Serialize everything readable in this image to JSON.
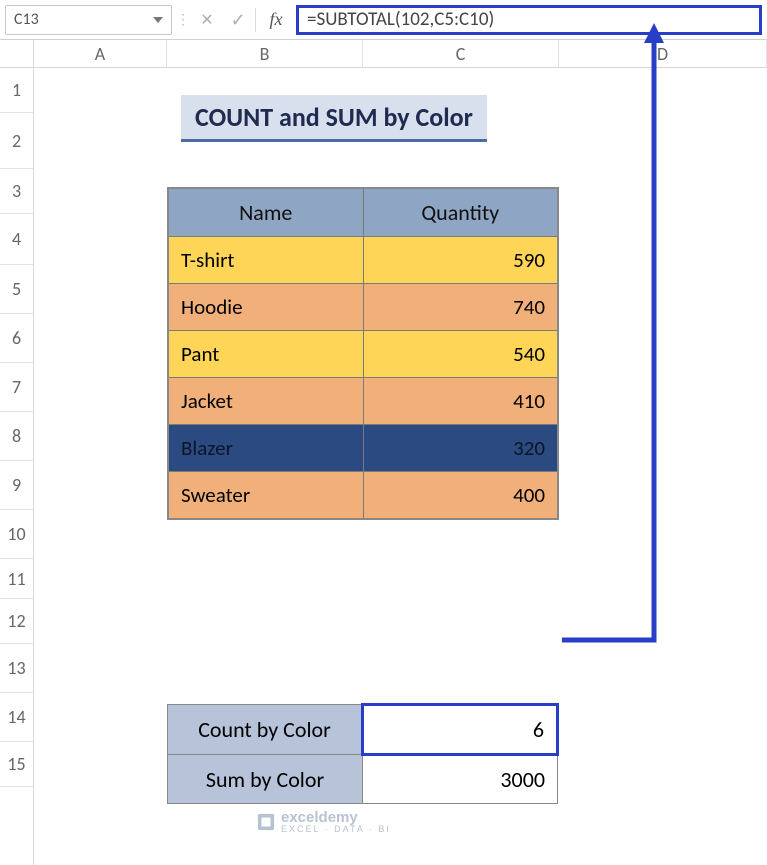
{
  "nameBox": "C13",
  "formula": "=SUBTOTAL(102,C5:C10)",
  "columns": [
    "A",
    "B",
    "C",
    "D"
  ],
  "rows": [
    "1",
    "2",
    "3",
    "4",
    "5",
    "6",
    "7",
    "8",
    "9",
    "10",
    "11",
    "12",
    "13",
    "14",
    "15"
  ],
  "title": "COUNT and SUM by Color",
  "headers": {
    "name": "Name",
    "qty": "Quantity"
  },
  "data": [
    {
      "name": "T-shirt",
      "quantity": "590",
      "style": "row-yellow"
    },
    {
      "name": "Hoodie",
      "quantity": "740",
      "style": "row-orange"
    },
    {
      "name": "Pant",
      "quantity": "540",
      "style": "row-yellow"
    },
    {
      "name": "Jacket",
      "quantity": "410",
      "style": "row-orange"
    },
    {
      "name": "Blazer",
      "quantity": "320",
      "style": "row-navy"
    },
    {
      "name": "Sweater",
      "quantity": "400",
      "style": "row-orange"
    }
  ],
  "summary": {
    "count_label": "Count by Color",
    "count_value": "6",
    "sum_label": "Sum by Color",
    "sum_value": "3000"
  },
  "watermark": {
    "brand": "exceldemy",
    "tag": "EXCEL · DATA · BI"
  }
}
